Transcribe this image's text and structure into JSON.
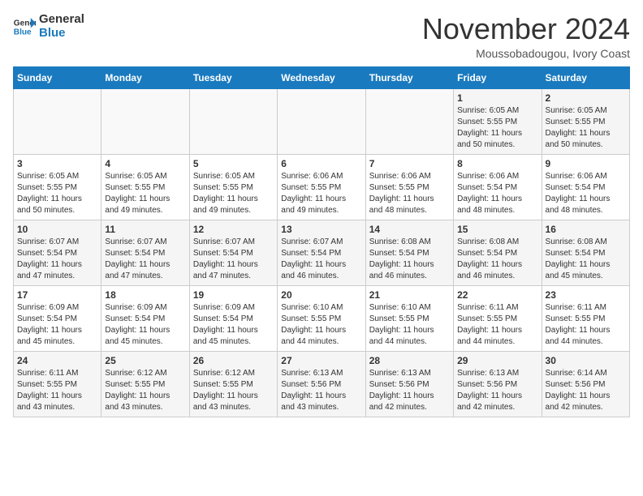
{
  "header": {
    "logo_line1": "General",
    "logo_line2": "Blue",
    "month": "November 2024",
    "location": "Moussobadougou, Ivory Coast"
  },
  "weekdays": [
    "Sunday",
    "Monday",
    "Tuesday",
    "Wednesday",
    "Thursday",
    "Friday",
    "Saturday"
  ],
  "weeks": [
    [
      {
        "day": "",
        "info": ""
      },
      {
        "day": "",
        "info": ""
      },
      {
        "day": "",
        "info": ""
      },
      {
        "day": "",
        "info": ""
      },
      {
        "day": "",
        "info": ""
      },
      {
        "day": "1",
        "info": "Sunrise: 6:05 AM\nSunset: 5:55 PM\nDaylight: 11 hours\nand 50 minutes."
      },
      {
        "day": "2",
        "info": "Sunrise: 6:05 AM\nSunset: 5:55 PM\nDaylight: 11 hours\nand 50 minutes."
      }
    ],
    [
      {
        "day": "3",
        "info": "Sunrise: 6:05 AM\nSunset: 5:55 PM\nDaylight: 11 hours\nand 50 minutes."
      },
      {
        "day": "4",
        "info": "Sunrise: 6:05 AM\nSunset: 5:55 PM\nDaylight: 11 hours\nand 49 minutes."
      },
      {
        "day": "5",
        "info": "Sunrise: 6:05 AM\nSunset: 5:55 PM\nDaylight: 11 hours\nand 49 minutes."
      },
      {
        "day": "6",
        "info": "Sunrise: 6:06 AM\nSunset: 5:55 PM\nDaylight: 11 hours\nand 49 minutes."
      },
      {
        "day": "7",
        "info": "Sunrise: 6:06 AM\nSunset: 5:55 PM\nDaylight: 11 hours\nand 48 minutes."
      },
      {
        "day": "8",
        "info": "Sunrise: 6:06 AM\nSunset: 5:54 PM\nDaylight: 11 hours\nand 48 minutes."
      },
      {
        "day": "9",
        "info": "Sunrise: 6:06 AM\nSunset: 5:54 PM\nDaylight: 11 hours\nand 48 minutes."
      }
    ],
    [
      {
        "day": "10",
        "info": "Sunrise: 6:07 AM\nSunset: 5:54 PM\nDaylight: 11 hours\nand 47 minutes."
      },
      {
        "day": "11",
        "info": "Sunrise: 6:07 AM\nSunset: 5:54 PM\nDaylight: 11 hours\nand 47 minutes."
      },
      {
        "day": "12",
        "info": "Sunrise: 6:07 AM\nSunset: 5:54 PM\nDaylight: 11 hours\nand 47 minutes."
      },
      {
        "day": "13",
        "info": "Sunrise: 6:07 AM\nSunset: 5:54 PM\nDaylight: 11 hours\nand 46 minutes."
      },
      {
        "day": "14",
        "info": "Sunrise: 6:08 AM\nSunset: 5:54 PM\nDaylight: 11 hours\nand 46 minutes."
      },
      {
        "day": "15",
        "info": "Sunrise: 6:08 AM\nSunset: 5:54 PM\nDaylight: 11 hours\nand 46 minutes."
      },
      {
        "day": "16",
        "info": "Sunrise: 6:08 AM\nSunset: 5:54 PM\nDaylight: 11 hours\nand 45 minutes."
      }
    ],
    [
      {
        "day": "17",
        "info": "Sunrise: 6:09 AM\nSunset: 5:54 PM\nDaylight: 11 hours\nand 45 minutes."
      },
      {
        "day": "18",
        "info": "Sunrise: 6:09 AM\nSunset: 5:54 PM\nDaylight: 11 hours\nand 45 minutes."
      },
      {
        "day": "19",
        "info": "Sunrise: 6:09 AM\nSunset: 5:54 PM\nDaylight: 11 hours\nand 45 minutes."
      },
      {
        "day": "20",
        "info": "Sunrise: 6:10 AM\nSunset: 5:55 PM\nDaylight: 11 hours\nand 44 minutes."
      },
      {
        "day": "21",
        "info": "Sunrise: 6:10 AM\nSunset: 5:55 PM\nDaylight: 11 hours\nand 44 minutes."
      },
      {
        "day": "22",
        "info": "Sunrise: 6:11 AM\nSunset: 5:55 PM\nDaylight: 11 hours\nand 44 minutes."
      },
      {
        "day": "23",
        "info": "Sunrise: 6:11 AM\nSunset: 5:55 PM\nDaylight: 11 hours\nand 44 minutes."
      }
    ],
    [
      {
        "day": "24",
        "info": "Sunrise: 6:11 AM\nSunset: 5:55 PM\nDaylight: 11 hours\nand 43 minutes."
      },
      {
        "day": "25",
        "info": "Sunrise: 6:12 AM\nSunset: 5:55 PM\nDaylight: 11 hours\nand 43 minutes."
      },
      {
        "day": "26",
        "info": "Sunrise: 6:12 AM\nSunset: 5:55 PM\nDaylight: 11 hours\nand 43 minutes."
      },
      {
        "day": "27",
        "info": "Sunrise: 6:13 AM\nSunset: 5:56 PM\nDaylight: 11 hours\nand 43 minutes."
      },
      {
        "day": "28",
        "info": "Sunrise: 6:13 AM\nSunset: 5:56 PM\nDaylight: 11 hours\nand 42 minutes."
      },
      {
        "day": "29",
        "info": "Sunrise: 6:13 AM\nSunset: 5:56 PM\nDaylight: 11 hours\nand 42 minutes."
      },
      {
        "day": "30",
        "info": "Sunrise: 6:14 AM\nSunset: 5:56 PM\nDaylight: 11 hours\nand 42 minutes."
      }
    ]
  ]
}
